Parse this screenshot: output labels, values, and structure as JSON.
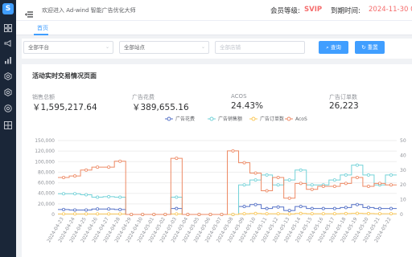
{
  "sidebar": {
    "logo_text": "S",
    "icons": [
      "dashboard-icon",
      "megaphone-icon",
      "bar-chart-icon",
      "settings-icon",
      "settings-alt-icon",
      "grid-icon"
    ]
  },
  "header": {
    "welcome": "欢迎进入 Ad-wind 智能广告优化大师",
    "member_label": "会员等级:",
    "member_value": "SVIP",
    "expire_label": "到期时间:",
    "expire_value": "2024-11-30 00:10"
  },
  "tabs": [
    {
      "label": "首页"
    }
  ],
  "filters": {
    "platform": "全部平台",
    "site": "全部站点",
    "shop_placeholder": "全部店铺",
    "search_label": "查询",
    "reset_label": "重置"
  },
  "section_title": "活动实时交易情况页面",
  "metrics": [
    {
      "label": "销售总额",
      "value": "￥1,595,217.64"
    },
    {
      "label": "广告花费",
      "value": "￥389,655.16"
    },
    {
      "label": "ACOS",
      "value": "24.43%"
    },
    {
      "label": "广告订单数",
      "value": "26,223"
    }
  ],
  "colors": {
    "accent": "#409eff",
    "spend": "#5470c6",
    "sales": "#73d2d8",
    "orders": "#fac858",
    "acos": "#ee8a65",
    "vip": "#f56c6c",
    "sidebar": "#1a2638"
  },
  "chart_data": {
    "type": "line",
    "legend_position": "top-center",
    "grid": true,
    "step": true,
    "y_left_ticks": [
      "0",
      "20,000",
      "40,000",
      "60,000",
      "80,000",
      "100,000",
      "120,000",
      "150,000"
    ],
    "y_right_ticks": [
      "0",
      "10",
      "20",
      "30",
      "40",
      "50"
    ],
    "ylim_left": [
      0,
      150000
    ],
    "ylim_right": [
      0,
      50
    ],
    "x": [
      "2024-04-23",
      "2024-04-24",
      "2024-04-25",
      "2024-04-26",
      "2024-04-27",
      "2024-04-28",
      "2024-04-29",
      "2024-04-30",
      "2024-05-01",
      "2024-05-02",
      "2024-05-03",
      "2024-05-04",
      "2024-05-05",
      "2024-05-06",
      "2024-05-07",
      "2024-05-08",
      "2024-05-09",
      "2024-05-10",
      "2024-05-11",
      "2024-05-12",
      "2024-05-13",
      "2024-05-14",
      "2024-05-15",
      "2024-05-16",
      "2024-05-17",
      "2024-05-18",
      "2024-05-19",
      "2024-05-20",
      "2024-05-21",
      "2024-05-22"
    ],
    "series": [
      {
        "name": "广告花费",
        "axis": "left",
        "values": [
          10000,
          9000,
          9000,
          11000,
          11000,
          10000,
          0,
          0,
          0,
          0,
          12000,
          0,
          0,
          0,
          0,
          0,
          16000,
          20000,
          12000,
          15000,
          8000,
          16000,
          12000,
          12000,
          12000,
          14000,
          20000,
          14000,
          12000,
          12000
        ]
      },
      {
        "name": "广告销售额",
        "axis": "left",
        "values": [
          42000,
          42000,
          40000,
          35000,
          36000,
          35000,
          0,
          0,
          0,
          0,
          35000,
          0,
          0,
          0,
          0,
          0,
          60000,
          70000,
          80000,
          60000,
          70000,
          90000,
          60000,
          60000,
          70000,
          80000,
          100000,
          80000,
          60000,
          80000
        ]
      },
      {
        "name": "广告订单数",
        "axis": "left",
        "values": [
          1000,
          1000,
          1000,
          1000,
          1000,
          1000,
          0,
          0,
          0,
          0,
          1000,
          0,
          0,
          0,
          0,
          0,
          1500,
          2000,
          1500,
          1500,
          1000,
          2000,
          1500,
          1500,
          1500,
          1800,
          2200,
          1800,
          1500,
          1500
        ]
      },
      {
        "name": "AcoS",
        "axis": "right",
        "values": [
          25,
          26,
          30,
          32,
          32,
          36,
          0,
          0,
          0,
          0,
          38,
          0,
          0,
          0,
          0,
          43,
          35,
          28,
          16,
          25,
          11,
          21,
          17,
          19,
          19,
          21,
          25,
          19,
          21,
          20
        ]
      }
    ]
  }
}
